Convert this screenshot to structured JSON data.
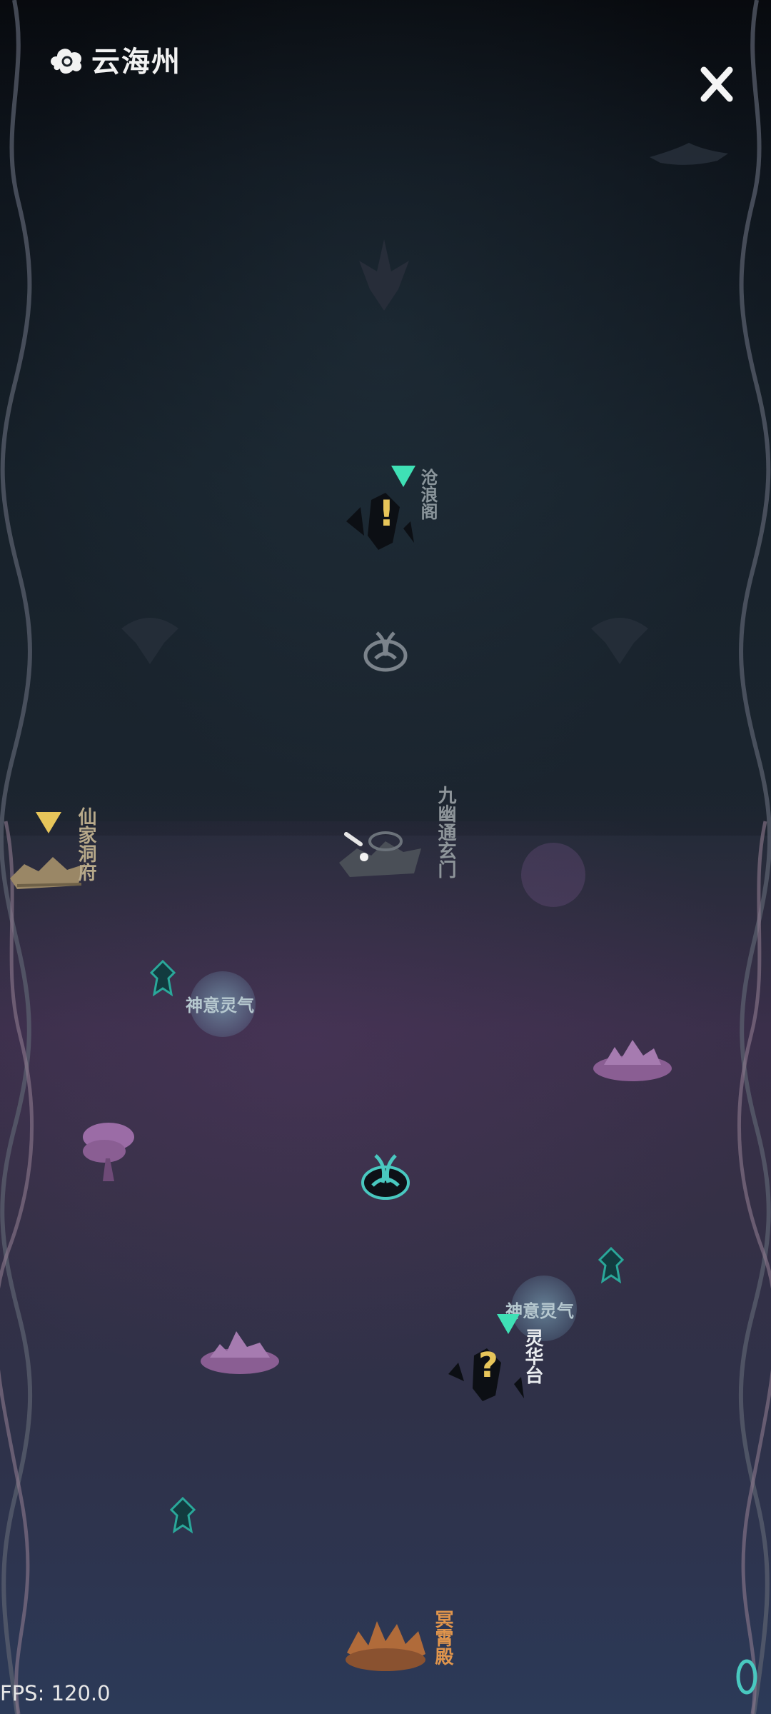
{
  "header": {
    "title": "云海州"
  },
  "locations": {
    "canglang": {
      "name": "沧浪阁"
    },
    "xianjia": {
      "name": "仙家洞府"
    },
    "jiuyou": {
      "name": "九幽通玄门"
    },
    "linghua": {
      "name": "灵华台"
    },
    "mingxiao": {
      "name": "冥霄殿"
    }
  },
  "qi_spots": [
    {
      "label": "神意灵气"
    },
    {
      "label": "神意灵气"
    }
  ],
  "markers": {
    "quest_exclaim": "!",
    "quest_question": "?"
  },
  "footer": {
    "fps": "FPS: 120.0"
  },
  "colors": {
    "accent_green": "#3fe0b5",
    "accent_gold": "#e7c55a",
    "location_orange": "#e0954c",
    "crystal_teal": "#1f8f86"
  }
}
